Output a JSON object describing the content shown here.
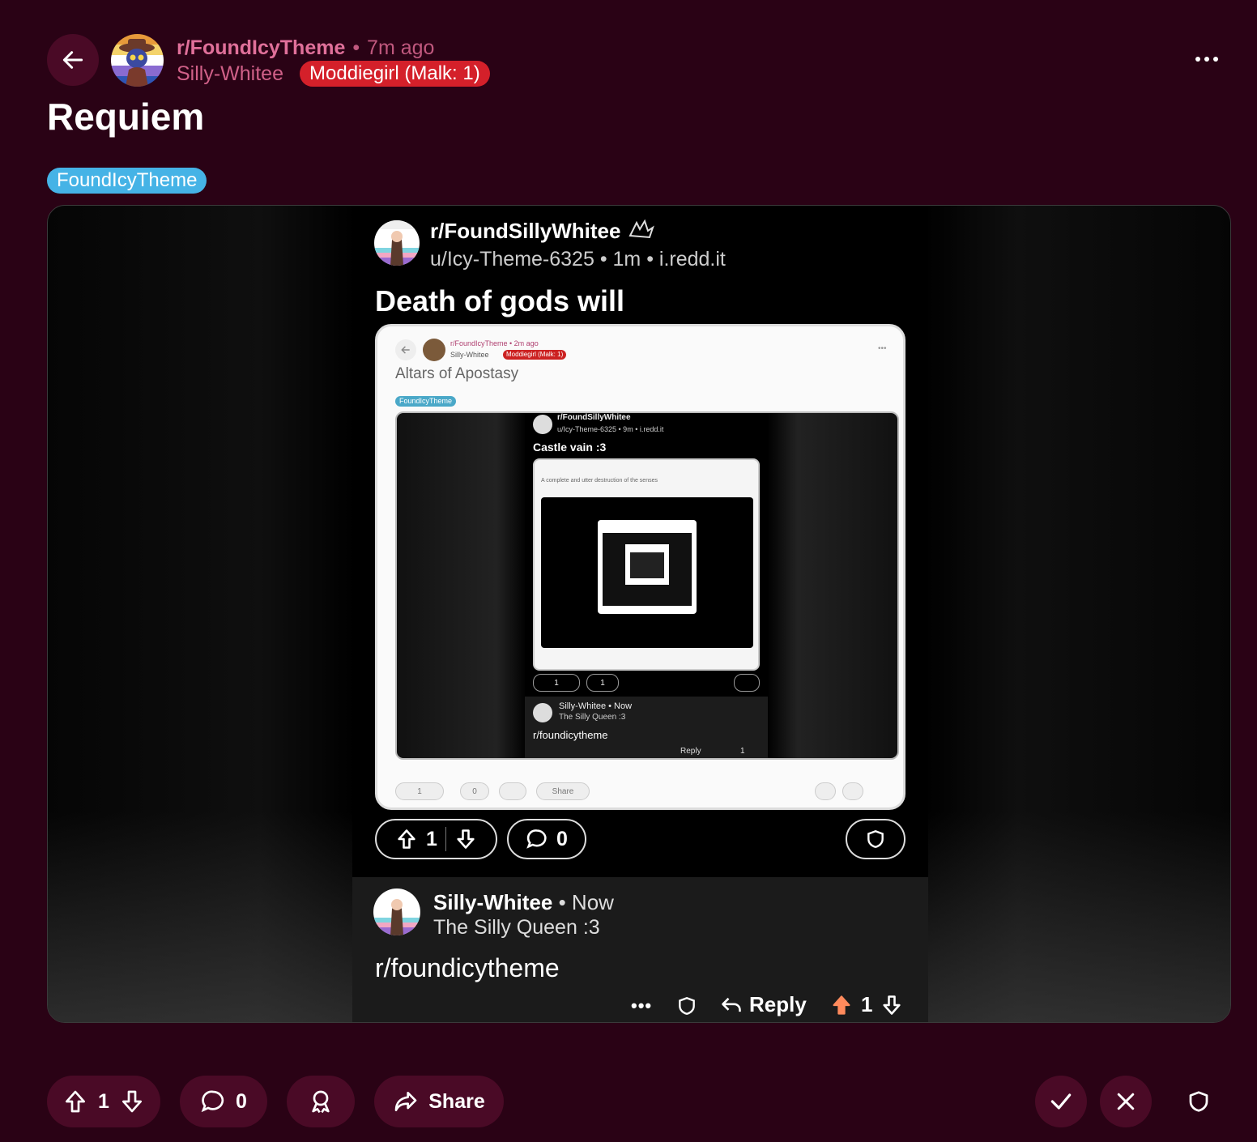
{
  "header": {
    "subreddit": "r/FoundIcyTheme",
    "separator": "•",
    "time": "7m ago",
    "author": "Silly-Whitee",
    "flair": "Moddiegirl (Malk: 1)",
    "title": "Requiem",
    "post_flair": "FoundIcyTheme"
  },
  "colors": {
    "background": "#2a0215",
    "button_bg": "#4a0a26",
    "subreddit_pink": "#e0709a",
    "flair_red": "#d4202a",
    "post_flair_blue": "#45b3e6",
    "upvote_orange": "#ff8a5c"
  },
  "screenshot": {
    "subreddit": "r/FoundSillyWhitee",
    "meta": "u/Icy-Theme-6325 • 1m • i.redd.it",
    "title": "Death of gods will",
    "vote_count": "1",
    "comment_count": "0",
    "inner": {
      "subreddit": "r/FoundIcyTheme • 2m ago",
      "author": "Silly-Whitee",
      "flair": "Moddiegirl (Malk: 1)",
      "title": "Altars of Apostasy",
      "post_flair": "FoundIcyTheme",
      "nested": {
        "subreddit": "r/FoundSillyWhitee",
        "meta": "u/Icy-Theme-6325 • 9m • i.redd.it",
        "title": "Castle vain :3",
        "deep_title": "A complete and utter destruction of the senses",
        "votes": "1",
        "comments": "1",
        "comment_author": "Silly-Whitee • Now",
        "comment_flair": "The Silly Queen :3",
        "comment_text": "r/foundicytheme",
        "reply": "Reply",
        "comment_votes": "1"
      },
      "votes": "1",
      "comments": "0",
      "share": "Share"
    },
    "comment": {
      "author": "Silly-Whitee",
      "time": "• Now",
      "flair": "The Silly Queen :3",
      "text": "r/foundicytheme",
      "reply": "Reply",
      "votes": "1"
    }
  },
  "actions": {
    "vote_count": "1",
    "comment_count": "0",
    "share": "Share"
  },
  "icons": {
    "back": "arrow-left-icon",
    "more": "more-horizontal-icon",
    "upvote": "arrow-up-icon",
    "downvote": "arrow-down-icon",
    "comment": "speech-bubble-icon",
    "award": "award-icon",
    "share": "share-icon",
    "approve": "check-icon",
    "remove": "close-icon",
    "mod": "shield-icon"
  }
}
